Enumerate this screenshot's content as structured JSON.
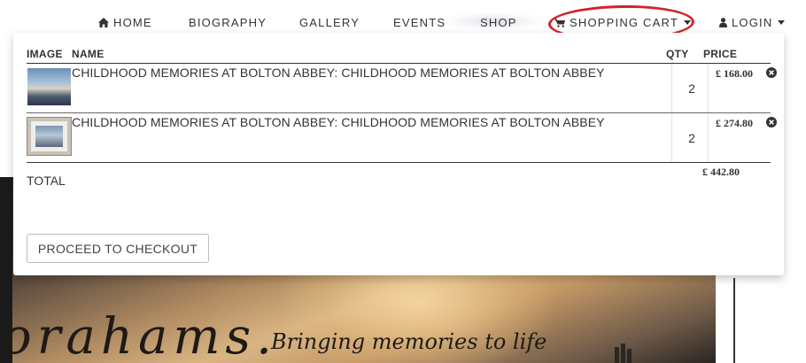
{
  "nav": {
    "items": [
      {
        "label": "HOME",
        "icon": "home-icon"
      },
      {
        "label": "BIOGRAPHY"
      },
      {
        "label": "GALLERY"
      },
      {
        "label": "EVENTS"
      },
      {
        "label": "SHOP"
      },
      {
        "label": "SHOPPING CART",
        "icon": "cart-icon",
        "dropdown": true
      },
      {
        "label": "LOGIN",
        "icon": "user-icon",
        "dropdown": true
      }
    ]
  },
  "annotation": {
    "shape": "ellipse",
    "color": "#d2232a",
    "target": "SHOPPING CART"
  },
  "cart": {
    "headers": {
      "image": "IMAGE",
      "name": "NAME",
      "qty": "QTY",
      "price": "PRICE"
    },
    "items": [
      {
        "name": "CHILDHOOD MEMORIES AT BOLTON ABBEY: CHILDHOOD MEMORIES AT BOLTON ABBEY",
        "qty": "2",
        "price": "£ 168.00",
        "thumb": "unframed-print"
      },
      {
        "name": "CHILDHOOD MEMORIES AT BOLTON ABBEY: CHILDHOOD MEMORIES AT BOLTON ABBEY",
        "qty": "2",
        "price": "£ 274.80",
        "thumb": "framed-print"
      }
    ],
    "total_label": "TOTAL",
    "total_value": "£ 442.80",
    "checkout_label": "PROCEED TO CHECKOUT"
  },
  "background_art": {
    "signature": "orahams.",
    "tagline": "Bringing memories to life"
  }
}
